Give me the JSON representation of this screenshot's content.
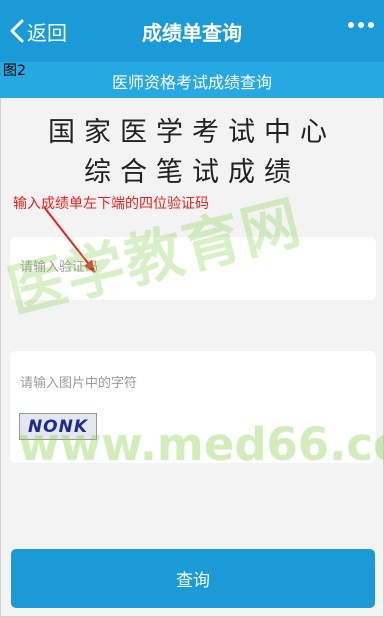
{
  "header": {
    "back_label": "返回",
    "title": "成绩单查询",
    "more_icon": "more-dots-icon"
  },
  "figure_tag": "图2",
  "subheader": {
    "title": "医师资格考试成绩查询"
  },
  "heading": {
    "line1": "国家医学考试中心",
    "line2": "综合笔试成绩"
  },
  "annotation": {
    "text": "输入成绩单左下端的四位验证码",
    "color": "#e8231f"
  },
  "form": {
    "verification_placeholder": "请输入验证码",
    "captcha_placeholder": "请输入图片中的字符",
    "captcha_text": "NONK"
  },
  "watermark": {
    "text_cn": "医学教育网",
    "text_url": "www.med66.com"
  },
  "button": {
    "query_label": "查询"
  },
  "colors": {
    "primary": "#1a9bd8",
    "subbar": "#26a8e3",
    "annotation": "#e8231f",
    "watermark": "#88d24d"
  }
}
